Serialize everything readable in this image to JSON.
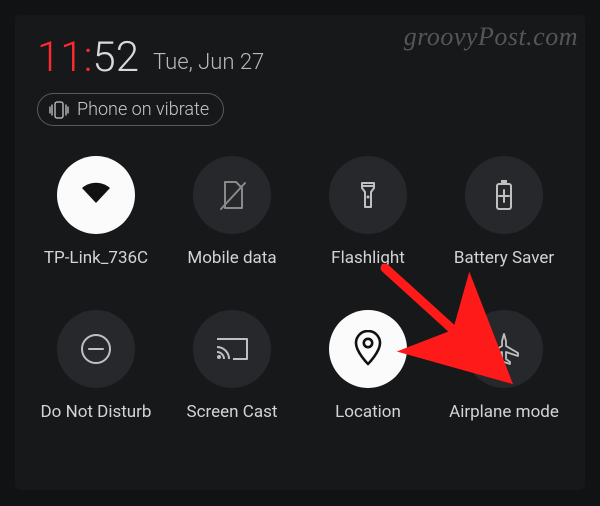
{
  "watermark": "groovyPost.com",
  "clock": {
    "hour": "11",
    "minute": "52"
  },
  "date": "Tue, Jun 27",
  "vibrate": {
    "label": "Phone on vibrate"
  },
  "tiles": {
    "wifi": {
      "label": "TP-Link_736C",
      "active": true
    },
    "mobile": {
      "label": "Mobile data",
      "active": false
    },
    "flash": {
      "label": "Flashlight",
      "active": false
    },
    "battery": {
      "label": "Battery Saver",
      "active": false
    },
    "dnd": {
      "label": "Do Not Disturb",
      "active": false
    },
    "cast": {
      "label": "Screen Cast",
      "active": false
    },
    "location": {
      "label": "Location",
      "active": true
    },
    "airplane": {
      "label": "Airplane mode",
      "active": false
    }
  },
  "icons": {
    "vibrate": "vibrate-icon",
    "wifi": "wifi-icon",
    "mobile": "sim-off-icon",
    "flash": "flashlight-icon",
    "battery": "battery-plus-icon",
    "dnd": "do-not-disturb-icon",
    "cast": "screen-cast-icon",
    "location": "location-pin-icon",
    "airplane": "airplane-icon"
  },
  "annotation": {
    "arrow_color": "#ff1a1a"
  }
}
